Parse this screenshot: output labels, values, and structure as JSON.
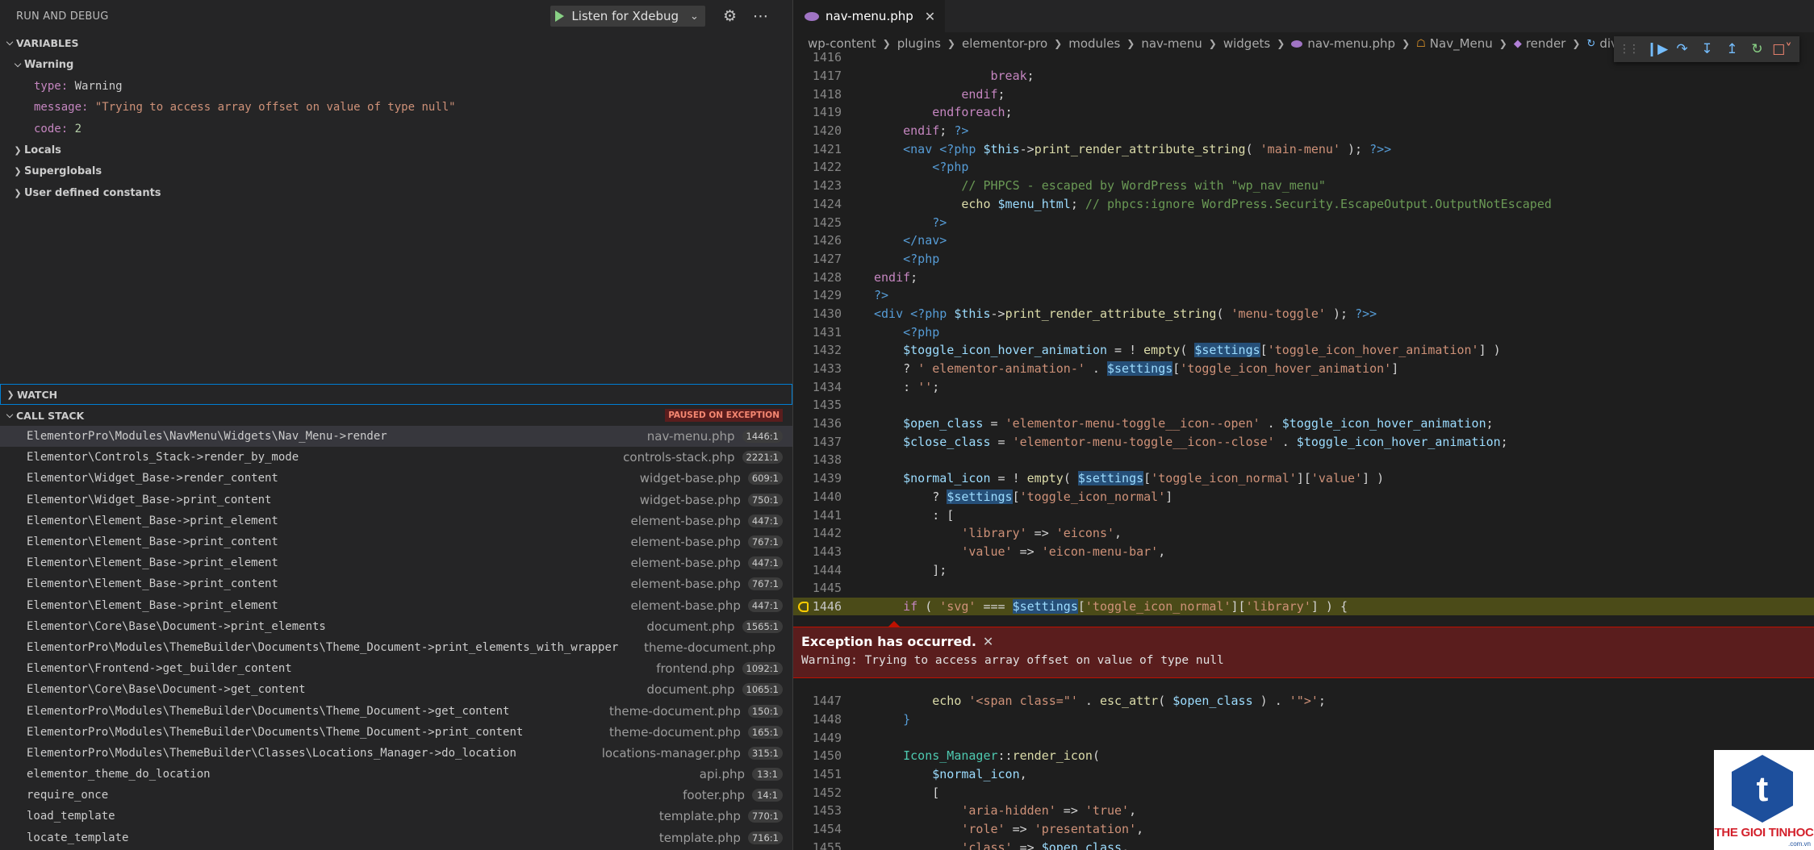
{
  "debug_panel": {
    "title": "RUN AND DEBUG",
    "launch_config": "Listen for Xdebug",
    "icons": [
      "play-icon",
      "chevron-down-icon",
      "gear-icon",
      "more-icon"
    ]
  },
  "variables": {
    "header": "VARIABLES",
    "warning": {
      "label": "Warning",
      "type_key": "type:",
      "type_val": "Warning",
      "message_key": "message:",
      "message_val": "\"Trying to access array offset on value of type null\"",
      "code_key": "code:",
      "code_val": "2"
    },
    "groups": [
      "Locals",
      "Superglobals",
      "User defined constants"
    ]
  },
  "watch": {
    "header": "WATCH"
  },
  "call_stack": {
    "header": "CALL STACK",
    "badge": "PAUSED ON EXCEPTION",
    "frames": [
      {
        "fn": "ElementorPro\\Modules\\NavMenu\\Widgets\\Nav_Menu->render",
        "file": "nav-menu.php",
        "line": "1446:1"
      },
      {
        "fn": "Elementor\\Controls_Stack->render_by_mode",
        "file": "controls-stack.php",
        "line": "2221:1"
      },
      {
        "fn": "Elementor\\Widget_Base->render_content",
        "file": "widget-base.php",
        "line": "609:1"
      },
      {
        "fn": "Elementor\\Widget_Base->print_content",
        "file": "widget-base.php",
        "line": "750:1"
      },
      {
        "fn": "Elementor\\Element_Base->print_element",
        "file": "element-base.php",
        "line": "447:1"
      },
      {
        "fn": "Elementor\\Element_Base->print_content",
        "file": "element-base.php",
        "line": "767:1"
      },
      {
        "fn": "Elementor\\Element_Base->print_element",
        "file": "element-base.php",
        "line": "447:1"
      },
      {
        "fn": "Elementor\\Element_Base->print_content",
        "file": "element-base.php",
        "line": "767:1"
      },
      {
        "fn": "Elementor\\Element_Base->print_element",
        "file": "element-base.php",
        "line": "447:1"
      },
      {
        "fn": "Elementor\\Core\\Base\\Document->print_elements",
        "file": "document.php",
        "line": "1565:1"
      },
      {
        "fn": "ElementorPro\\Modules\\ThemeBuilder\\Documents\\Theme_Document->print_elements_with_wrapper",
        "file": "theme-document.php",
        "line": ""
      },
      {
        "fn": "Elementor\\Frontend->get_builder_content",
        "file": "frontend.php",
        "line": "1092:1"
      },
      {
        "fn": "Elementor\\Core\\Base\\Document->get_content",
        "file": "document.php",
        "line": "1065:1"
      },
      {
        "fn": "ElementorPro\\Modules\\ThemeBuilder\\Documents\\Theme_Document->get_content",
        "file": "theme-document.php",
        "line": "150:1"
      },
      {
        "fn": "ElementorPro\\Modules\\ThemeBuilder\\Documents\\Theme_Document->print_content",
        "file": "theme-document.php",
        "line": "165:1"
      },
      {
        "fn": "ElementorPro\\Modules\\ThemeBuilder\\Classes\\Locations_Manager->do_location",
        "file": "locations-manager.php",
        "line": "315:1"
      },
      {
        "fn": "elementor_theme_do_location",
        "file": "api.php",
        "line": "13:1"
      },
      {
        "fn": "require_once",
        "file": "footer.php",
        "line": "14:1"
      },
      {
        "fn": "load_template",
        "file": "template.php",
        "line": "770:1"
      },
      {
        "fn": "locate_template",
        "file": "template.php",
        "line": "716:1"
      }
    ]
  },
  "editor": {
    "tab": "nav-menu.php",
    "breadcrumbs": [
      "wp-content",
      "plugins",
      "elementor-pro",
      "modules",
      "nav-menu",
      "widgets",
      "nav-menu.php",
      "Nav_Menu",
      "render",
      "div"
    ],
    "exception": {
      "title": "Exception has occurred.",
      "message": "Warning: Trying to access array offset on value of type null"
    },
    "current_line": "1446"
  },
  "logo": {
    "brand": "THE GIOI TINHOC",
    "sub": ".com.vn",
    "glyph": "t"
  }
}
